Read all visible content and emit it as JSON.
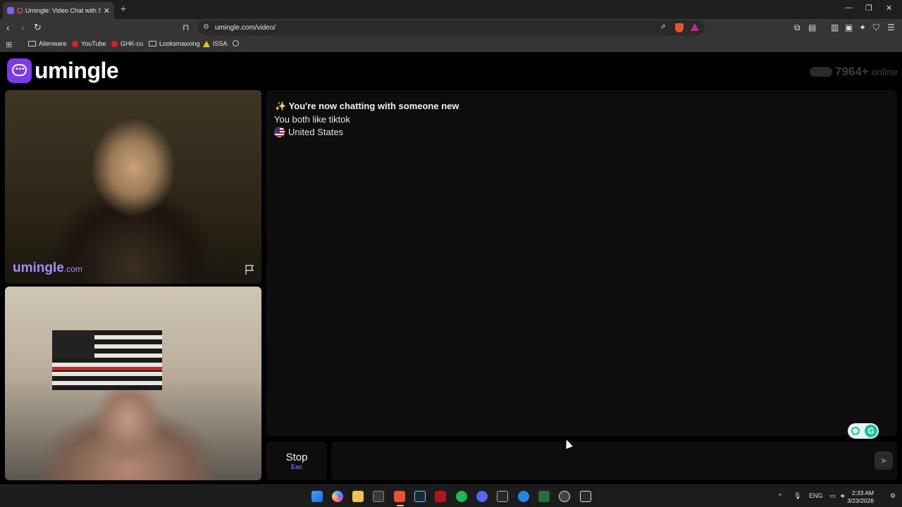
{
  "browser": {
    "tab_title": "Umingle: Video Chat with Str",
    "new_tab_symbol": "+",
    "url": "umingle.com/video/",
    "bookmarks": [
      "Alienware",
      "YouTube",
      "GHK-cu",
      "Looksmaxxing",
      "ISSA"
    ]
  },
  "site": {
    "logo_text": "umingle",
    "online_count": "7964+",
    "online_label": "online",
    "watermark_main": "umingle",
    "watermark_suffix": ".com"
  },
  "chat": {
    "system_message": "✨ You're now chatting with someone new",
    "interest_message": "You both like tiktok",
    "country": "United States"
  },
  "controls": {
    "stop_label": "Stop",
    "stop_key": "Esc",
    "send_icon": "send-icon"
  },
  "taskbar": {
    "language": "ENG",
    "time": "2:33 AM",
    "date": "3/23/2026"
  },
  "colors": {
    "brand_purple": "#7c3aed",
    "accent_purple": "#8b5cf6",
    "grammarly_green": "#15c39a"
  }
}
